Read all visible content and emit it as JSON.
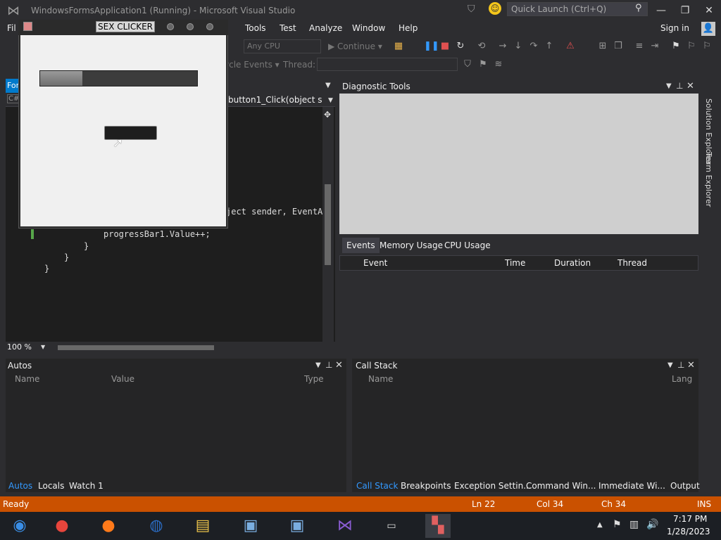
{
  "title_bar": {
    "app_title": "WindowsFormsApplication1 (Running) - Microsoft Visual Studio",
    "quick_launch_placeholder": "Quick Launch (Ctrl+Q)"
  },
  "menu": [
    "Fil",
    "Tools",
    "Test",
    "Analyze",
    "Window",
    "Help"
  ],
  "sign_in": "Sign in",
  "toolbar": {
    "cpu": "Any CPU",
    "continue": "▶ Continue ▾",
    "lifecycle": "ycle Events ▾",
    "thread": "Thread:"
  },
  "editor": {
    "tab": "For",
    "nav_cs": "C#",
    "nav_method": "button1_Click(object s",
    "code": {
      "sig": "ject sender, EventAr",
      "inc": "progressBar1.Value++;",
      "b1": "}",
      "b2": "}",
      "b3": "}"
    },
    "zoom": "100 %"
  },
  "diagnostic": {
    "title": "Diagnostic Tools",
    "tabs": [
      "Events",
      "Memory Usage",
      "CPU Usage"
    ],
    "columns": [
      "Event",
      "Time",
      "Duration",
      "Thread"
    ]
  },
  "autos": {
    "title": "Autos",
    "columns": [
      "Name",
      "Value",
      "Type"
    ],
    "tabs": [
      "Autos",
      "Locals",
      "Watch 1"
    ]
  },
  "callstack": {
    "title": "Call Stack",
    "columns": [
      "Name",
      "Lang"
    ],
    "tabs": [
      "Call Stack",
      "Breakpoints",
      "Exception Settin...",
      "Command Win...",
      "Immediate Wi...",
      "Output"
    ]
  },
  "status": {
    "ready": "Ready",
    "ln": "Ln 22",
    "col": "Col 34",
    "ch": "Ch 34",
    "ins": "INS"
  },
  "clock": {
    "time": "7:17 PM",
    "date": "1/28/2023"
  },
  "form_window": {
    "title": "SEX CLICKER",
    "progress_fraction": 0.27
  },
  "colors": {
    "accent": "#007acc",
    "status_bar": "#ca5100",
    "link": "#3399ff"
  }
}
